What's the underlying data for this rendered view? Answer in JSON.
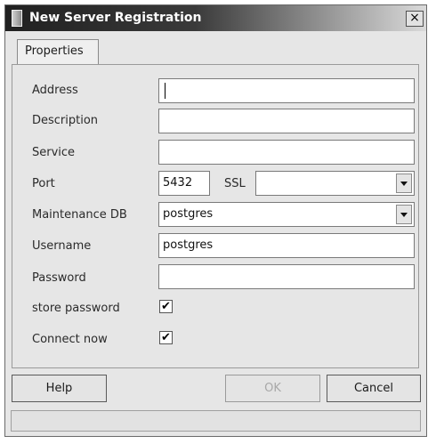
{
  "window": {
    "title": "New Server Registration",
    "close_glyph": "×"
  },
  "tabs": [
    {
      "label": "Properties"
    }
  ],
  "form": {
    "address": {
      "label": "Address",
      "value": ""
    },
    "description": {
      "label": "Description",
      "value": ""
    },
    "service": {
      "label": "Service",
      "value": ""
    },
    "port": {
      "label": "Port",
      "value": "5432"
    },
    "ssl": {
      "label": "SSL",
      "value": ""
    },
    "maintenance_db": {
      "label": "Maintenance DB",
      "value": "postgres"
    },
    "username": {
      "label": "Username",
      "value": "postgres"
    },
    "password": {
      "label": "Password",
      "value": ""
    },
    "store_password": {
      "label": "store password",
      "checked": true,
      "mark": "✔"
    },
    "connect_now": {
      "label": "Connect now",
      "checked": true,
      "mark": "✔"
    }
  },
  "buttons": {
    "help": "Help",
    "ok": "OK",
    "cancel": "Cancel"
  },
  "status": {
    "text": ""
  }
}
